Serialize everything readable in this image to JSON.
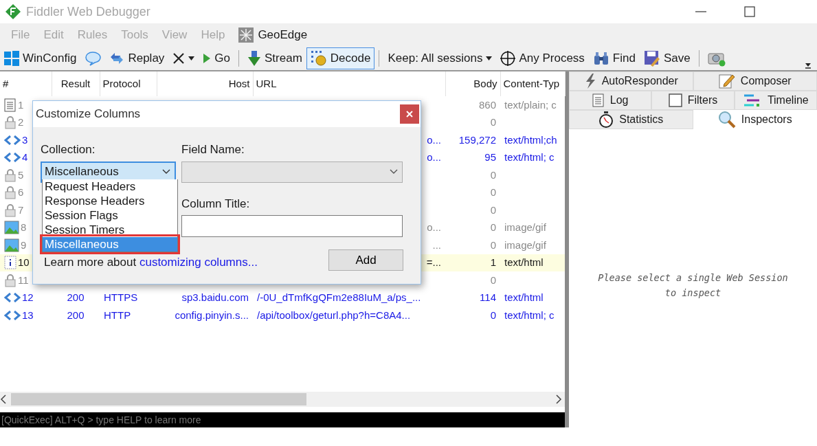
{
  "window": {
    "title": "Fiddler Web Debugger"
  },
  "menu": [
    {
      "label": "File",
      "dimmed": true
    },
    {
      "label": "Edit",
      "dimmed": true
    },
    {
      "label": "Rules",
      "dimmed": true
    },
    {
      "label": "Tools",
      "dimmed": true
    },
    {
      "label": "View",
      "dimmed": true
    },
    {
      "label": "Help",
      "dimmed": true
    },
    {
      "label": "GeoEdge",
      "dimmed": false
    }
  ],
  "toolbar": [
    {
      "kind": "button",
      "label": "WinConfig",
      "pressed": false
    },
    {
      "kind": "button",
      "pressed": false
    },
    {
      "kind": "button",
      "label": "Replay",
      "pressed": false
    },
    {
      "kind": "dropdown",
      "pressed": false
    },
    {
      "kind": "button",
      "label": "Go",
      "pressed": false
    },
    {
      "kind": "separator"
    },
    {
      "kind": "button",
      "label": "Stream",
      "pressed": false
    },
    {
      "kind": "button",
      "label": "Decode",
      "pressed": true
    },
    {
      "kind": "separator"
    },
    {
      "kind": "dropdown",
      "label": "Keep: All sessions",
      "pressed": false
    },
    {
      "kind": "button",
      "label": "Any Process",
      "pressed": false
    },
    {
      "kind": "button",
      "label": "Find",
      "pressed": false
    },
    {
      "kind": "button",
      "label": "Save",
      "pressed": false
    },
    {
      "kind": "separator"
    },
    {
      "kind": "button",
      "pressed": false
    }
  ],
  "sessions": {
    "columns": [
      "#",
      "Result",
      "Protocol",
      "Host",
      "URL",
      "Body",
      "Content-Typ"
    ],
    "rows": [
      {
        "kind": "doc",
        "num": "1",
        "color": "#8a8a8a",
        "highlight": false,
        "body": "860",
        "content_type": "text/plain; c"
      },
      {
        "kind": "lock",
        "num": "2",
        "color": "#8a8a8a",
        "highlight": false,
        "body": "0"
      },
      {
        "kind": "arrows",
        "num": "3",
        "color": "#1a1ae6",
        "highlight": false,
        "url": "o...",
        "body": "159,272",
        "content_type": "text/html;ch"
      },
      {
        "kind": "arrows",
        "num": "4",
        "color": "#1a1ae6",
        "highlight": false,
        "url": "o...",
        "body": "95",
        "content_type": "text/html; c"
      },
      {
        "kind": "lock",
        "num": "5",
        "color": "#8a8a8a",
        "highlight": false,
        "body": "0"
      },
      {
        "kind": "lock",
        "num": "6",
        "color": "#8a8a8a",
        "highlight": false,
        "body": "0"
      },
      {
        "kind": "lock",
        "num": "7",
        "color": "#8a8a8a",
        "highlight": false,
        "body": "0"
      },
      {
        "kind": "image",
        "num": "8",
        "color": "#8a8a8a",
        "highlight": false,
        "url": "o...",
        "body": "0",
        "content_type": "image/gif"
      },
      {
        "kind": "image",
        "num": "9",
        "color": "#8a8a8a",
        "highlight": false,
        "url": "...",
        "body": "0",
        "content_type": "image/gif"
      },
      {
        "kind": "info",
        "num": "10",
        "color": "#1a1a1a",
        "highlight": true,
        "url": "=...",
        "body": "1",
        "content_type": "text/html"
      },
      {
        "kind": "lock",
        "num": "11",
        "color": "#8a8a8a",
        "highlight": false,
        "body": "0"
      },
      {
        "kind": "arrows",
        "num": "12",
        "color": "#1a1ae6",
        "highlight": false,
        "result": "200",
        "protocol": "HTTPS",
        "host": "sp3.baidu.com",
        "url": "/-0U_dTmfKgQFm2e88IuM_a/ps_...",
        "body": "114",
        "content_type": "text/html"
      },
      {
        "kind": "arrows",
        "num": "13",
        "color": "#1a1ae6",
        "highlight": false,
        "result": "200",
        "protocol": "HTTP",
        "host": "config.pinyin.s...",
        "url": "/api/toolbox/geturl.php?h=C8A4...",
        "body": "0",
        "content_type": "text/html; c"
      }
    ]
  },
  "dialog": {
    "title": "Customize Columns",
    "collection_label": "Collection:",
    "collection_value": "Miscellaneous",
    "options": [
      {
        "label": "Request Headers",
        "selected": false
      },
      {
        "label": "Response Headers",
        "selected": false
      },
      {
        "label": "Session Flags",
        "selected": false
      },
      {
        "label": "Session Timers",
        "selected": false
      },
      {
        "label": "Miscellaneous",
        "selected": true
      }
    ],
    "field_name_label": "Field Name:",
    "field_name_disabled": true,
    "column_title_label": "Column Title:",
    "learn_more": {
      "text": "Learn more about ",
      "link": "customizing columns..."
    },
    "add_button": "Add"
  },
  "inspector_tabs": [
    [
      {
        "label": "AutoResponder",
        "selected": false
      },
      {
        "label": "Composer",
        "selected": false
      }
    ],
    [
      {
        "label": "Log",
        "selected": false
      },
      {
        "label": "Filters",
        "selected": false
      },
      {
        "label": "Timeline",
        "selected": false
      }
    ],
    [
      {
        "label": "Statistics",
        "selected": false
      },
      {
        "label": "Inspectors",
        "selected": true
      }
    ]
  ],
  "inspector_message": "Please select a single Web Session to inspect",
  "quickexec": {
    "placeholder": "[QuickExec] ALT+Q > type HELP to learn more"
  }
}
